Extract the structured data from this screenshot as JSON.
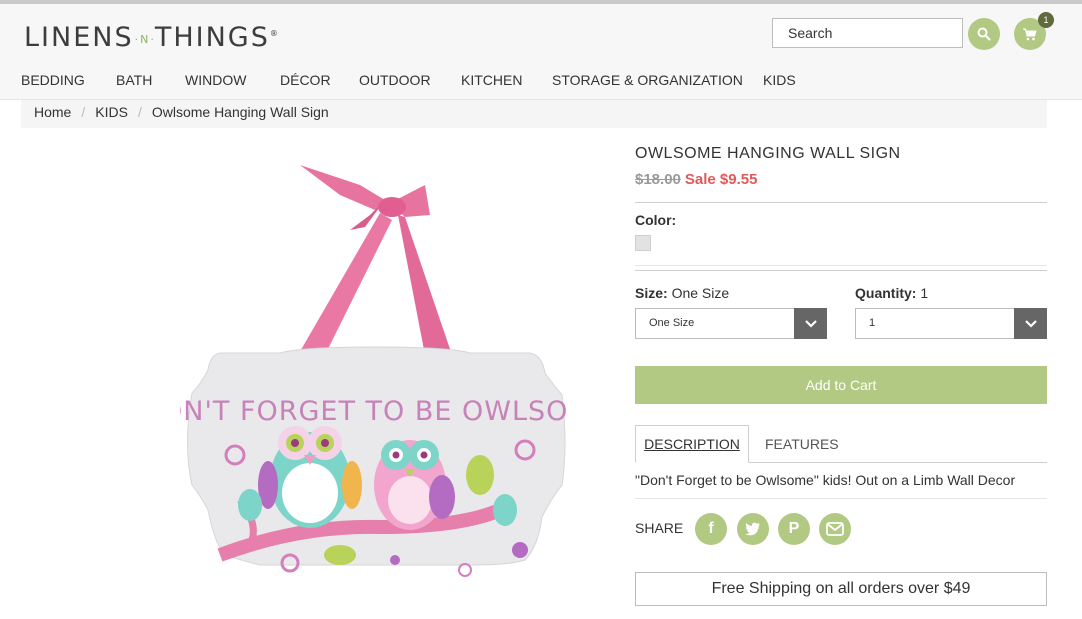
{
  "brand": {
    "logo_left": "LINENS",
    "logo_mid": "N",
    "logo_right": "THINGS"
  },
  "header": {
    "search_placeholder": "Search",
    "cart_count": "1",
    "accent_color": "#b1c982"
  },
  "nav": [
    "BEDDING",
    "BATH",
    "WINDOW",
    "DÉCOR",
    "OUTDOOR",
    "KITCHEN",
    "STORAGE & ORGANIZATION",
    "KIDS"
  ],
  "breadcrumb": [
    "Home",
    "KIDS",
    "Owlsome Hanging Wall Sign"
  ],
  "product": {
    "title": "OWLSOME HANGING WALL SIGN",
    "original_price": "$18.00",
    "sale_price": "Sale $9.55",
    "color_label": "Color:",
    "size_label": "Size:",
    "size_value": "One Size",
    "size_select": "One Size",
    "quantity_label": "Quantity:",
    "quantity_value": "1",
    "quantity_select": "1",
    "add_to_cart": "Add to Cart",
    "sign_text": "DON'T FORGET TO BE OWLSOME"
  },
  "tabs": {
    "description": "DESCRIPTION",
    "features": "FEATURES"
  },
  "description_text": "\"Don't Forget to be Owlsome\" kids! Out on a Limb Wall Decor",
  "share_label": "SHARE",
  "shipping_text": "Free Shipping on all orders over $49"
}
